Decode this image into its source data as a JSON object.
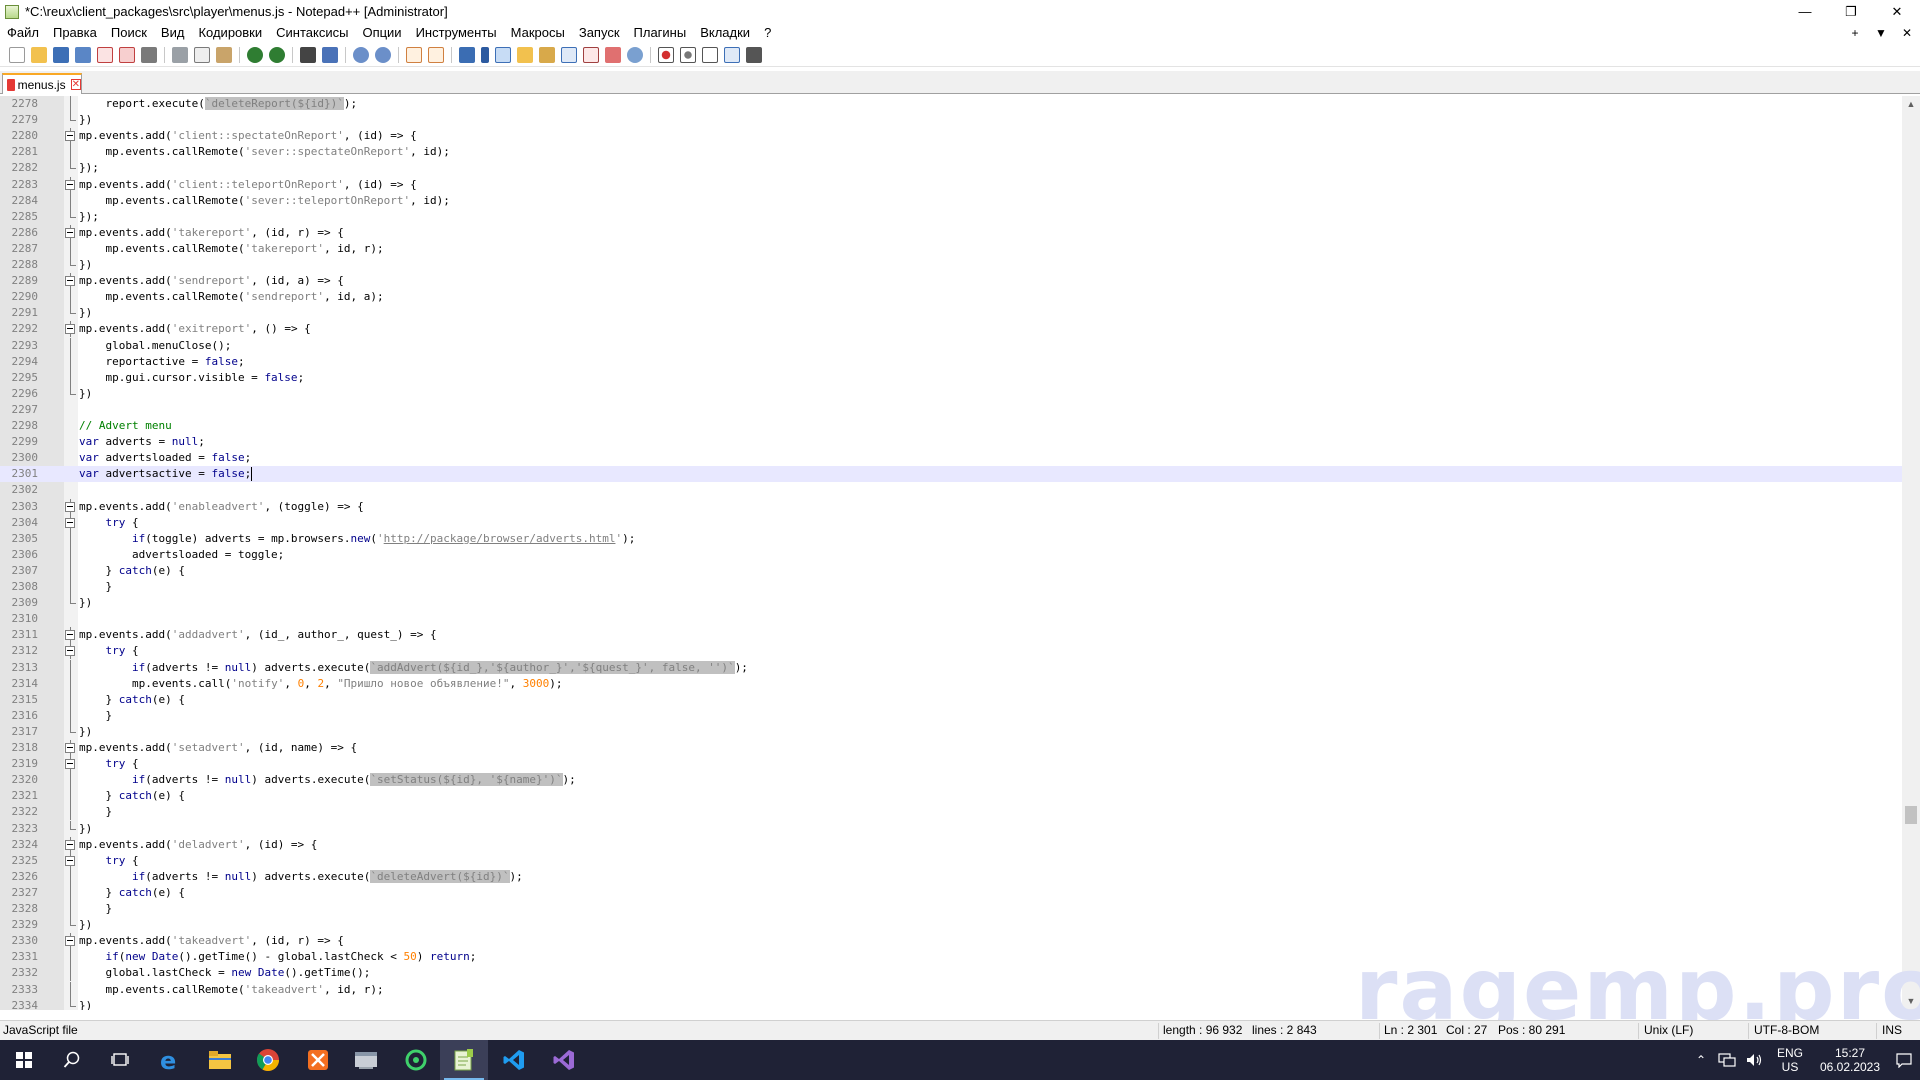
{
  "window": {
    "title": "*C:\\reux\\client_packages\\src\\player\\menus.js - Notepad++ [Administrator]",
    "min_glyph": "—",
    "max_glyph": "❐",
    "close_glyph": "✕"
  },
  "menu": {
    "items": [
      "Файл",
      "Правка",
      "Поиск",
      "Вид",
      "Кодировки",
      "Синтаксисы",
      "Опции",
      "Инструменты",
      "Макросы",
      "Запуск",
      "Плагины",
      "Вкладки",
      "?"
    ],
    "right": [
      "+",
      "▼",
      "✕"
    ]
  },
  "tab": {
    "label": "menus.js",
    "close": "✕"
  },
  "editor": {
    "lines": [
      {
        "n": "2278",
        "f": "v",
        "html": "    report.execute(<span class=\"tpl\">`deleteReport(${id})`</span>);"
      },
      {
        "n": "2279",
        "f": "e",
        "html": "})"
      },
      {
        "n": "2280",
        "f": "b",
        "html": "mp.events.add(<span class=\"str\">'client::spectateOnReport'</span>, (id) =&gt; {"
      },
      {
        "n": "2281",
        "f": "v",
        "html": "    mp.events.callRemote(<span class=\"str\">'sever::spectateOnReport'</span>, id);"
      },
      {
        "n": "2282",
        "f": "e",
        "html": "});"
      },
      {
        "n": "2283",
        "f": "b",
        "html": "mp.events.add(<span class=\"str\">'client::teleportOnReport'</span>, (id) =&gt; {"
      },
      {
        "n": "2284",
        "f": "v",
        "html": "    mp.events.callRemote(<span class=\"str\">'sever::teleportOnReport'</span>, id);"
      },
      {
        "n": "2285",
        "f": "e",
        "html": "});"
      },
      {
        "n": "2286",
        "f": "b",
        "html": "mp.events.add(<span class=\"str\">'takereport'</span>, (id, r) =&gt; {"
      },
      {
        "n": "2287",
        "f": "v",
        "html": "    mp.events.callRemote(<span class=\"str\">'takereport'</span>, id, r);"
      },
      {
        "n": "2288",
        "f": "e",
        "html": "})"
      },
      {
        "n": "2289",
        "f": "b",
        "html": "mp.events.add(<span class=\"str\">'sendreport'</span>, (id, a) =&gt; {"
      },
      {
        "n": "2290",
        "f": "v",
        "html": "    mp.events.callRemote(<span class=\"str\">'sendreport'</span>, id, a);"
      },
      {
        "n": "2291",
        "f": "e",
        "html": "})"
      },
      {
        "n": "2292",
        "f": "b",
        "html": "mp.events.add(<span class=\"str\">'exitreport'</span>, () =&gt; {"
      },
      {
        "n": "2293",
        "f": "v",
        "html": "    global.menuClose();"
      },
      {
        "n": "2294",
        "f": "v",
        "html": "    reportactive = <span class=\"kw\">false</span>;"
      },
      {
        "n": "2295",
        "f": "v",
        "html": "    mp.gui.cursor.visible = <span class=\"kw\">false</span>;"
      },
      {
        "n": "2296",
        "f": "e",
        "html": "})"
      },
      {
        "n": "2297",
        "f": "",
        "html": ""
      },
      {
        "n": "2298",
        "f": "",
        "html": "<span class=\"cm\">// Advert menu</span>"
      },
      {
        "n": "2299",
        "f": "",
        "html": "<span class=\"kw\">var</span> adverts = <span class=\"kw\">null</span>;"
      },
      {
        "n": "2300",
        "f": "",
        "html": "<span class=\"kw\">var</span> advertsloaded = <span class=\"kw\">false</span>;"
      },
      {
        "n": "2301",
        "f": "",
        "cur": true,
        "html": "<span class=\"kw\">var</span> advertsactive = <span class=\"kw\">false</span>;<span class=\"cursor\"></span>"
      },
      {
        "n": "2302",
        "f": "",
        "html": ""
      },
      {
        "n": "2303",
        "f": "b",
        "html": "mp.events.add(<span class=\"str\">'enableadvert'</span>, (toggle) =&gt; {"
      },
      {
        "n": "2304",
        "f": "b",
        "html": "    <span class=\"kw\">try</span> {"
      },
      {
        "n": "2305",
        "f": "v",
        "html": "        <span class=\"kw\">if</span>(toggle) adverts = mp.browsers.<span class=\"kw\">new</span>(<span class=\"str\">'</span><span class=\"url\">http://package/browser/adverts.html</span><span class=\"str\">'</span>);"
      },
      {
        "n": "2306",
        "f": "v",
        "html": "        advertsloaded = toggle;"
      },
      {
        "n": "2307",
        "f": "v",
        "html": "    } <span class=\"kw\">catch</span>(e) {"
      },
      {
        "n": "2308",
        "f": "v",
        "html": "    }"
      },
      {
        "n": "2309",
        "f": "e",
        "html": "})"
      },
      {
        "n": "2310",
        "f": "",
        "html": ""
      },
      {
        "n": "2311",
        "f": "b",
        "html": "mp.events.add(<span class=\"str\">'addadvert'</span>, (id_, author_, quest_) =&gt; {"
      },
      {
        "n": "2312",
        "f": "b",
        "html": "    <span class=\"kw\">try</span> {"
      },
      {
        "n": "2313",
        "f": "v",
        "html": "        <span class=\"kw\">if</span>(adverts != <span class=\"kw\">null</span>) adverts.execute(<span class=\"tpl\">`addAdvert(${id_},'${author_}','${quest_}', false, '')`</span>);"
      },
      {
        "n": "2314",
        "f": "v",
        "html": "        mp.events.call(<span class=\"str\">'notify'</span>, <span class=\"num\">0</span>, <span class=\"num\">2</span>, <span class=\"str\">\"Пришло новое объявление!\"</span>, <span class=\"num\">3000</span>);"
      },
      {
        "n": "2315",
        "f": "v",
        "html": "    } <span class=\"kw\">catch</span>(e) {"
      },
      {
        "n": "2316",
        "f": "v",
        "html": "    }"
      },
      {
        "n": "2317",
        "f": "e",
        "html": "})"
      },
      {
        "n": "2318",
        "f": "b",
        "html": "mp.events.add(<span class=\"str\">'setadvert'</span>, (id, name) =&gt; {"
      },
      {
        "n": "2319",
        "f": "b",
        "html": "    <span class=\"kw\">try</span> {"
      },
      {
        "n": "2320",
        "f": "v",
        "html": "        <span class=\"kw\">if</span>(adverts != <span class=\"kw\">null</span>) adverts.execute(<span class=\"tpl\">`setStatus(${id}, '${name}')`</span>);"
      },
      {
        "n": "2321",
        "f": "v",
        "html": "    } <span class=\"kw\">catch</span>(e) {"
      },
      {
        "n": "2322",
        "f": "v",
        "html": "    }"
      },
      {
        "n": "2323",
        "f": "e",
        "html": "})"
      },
      {
        "n": "2324",
        "f": "b",
        "html": "mp.events.add(<span class=\"str\">'deladvert'</span>, (id) =&gt; {"
      },
      {
        "n": "2325",
        "f": "b",
        "html": "    <span class=\"kw\">try</span> {"
      },
      {
        "n": "2326",
        "f": "v",
        "html": "        <span class=\"kw\">if</span>(adverts != <span class=\"kw\">null</span>) adverts.execute(<span class=\"tpl\">`deleteAdvert(${id})`</span>);"
      },
      {
        "n": "2327",
        "f": "v",
        "html": "    } <span class=\"kw\">catch</span>(e) {"
      },
      {
        "n": "2328",
        "f": "v",
        "html": "    }"
      },
      {
        "n": "2329",
        "f": "e",
        "html": "})"
      },
      {
        "n": "2330",
        "f": "b",
        "html": "mp.events.add(<span class=\"str\">'takeadvert'</span>, (id, r) =&gt; {"
      },
      {
        "n": "2331",
        "f": "v",
        "html": "    <span class=\"kw\">if</span>(<span class=\"kw\">new</span> <span class=\"kw\">Date</span>().getTime() - global.lastCheck &lt; <span class=\"num\">50</span>) <span class=\"kw\">return</span>;"
      },
      {
        "n": "2332",
        "f": "v",
        "html": "    global.lastCheck = <span class=\"kw\">new</span> <span class=\"kw\">Date</span>().getTime();"
      },
      {
        "n": "2333",
        "f": "v",
        "html": "    mp.events.callRemote(<span class=\"str\">'takeadvert'</span>, id, r);"
      },
      {
        "n": "2334",
        "f": "e",
        "html": "})"
      }
    ]
  },
  "watermark": "ragemp.pro",
  "status": {
    "filetype": "JavaScript file",
    "length": "length : 96 932",
    "lines": "lines : 2 843",
    "ln": "Ln : 2 301",
    "col": "Col : 27",
    "pos": "Pos : 80 291",
    "eol": "Unix (LF)",
    "encoding": "UTF-8-BOM",
    "mode": "INS"
  },
  "taskbar": {
    "lang_top": "ENG",
    "lang_bottom": "US",
    "time": "15:27",
    "date": "06.02.2023"
  },
  "colors": {
    "keyword": "#00008b",
    "string": "#808080",
    "number": "#ff8000",
    "comment": "#008000",
    "taskbar": "#1f2236"
  }
}
